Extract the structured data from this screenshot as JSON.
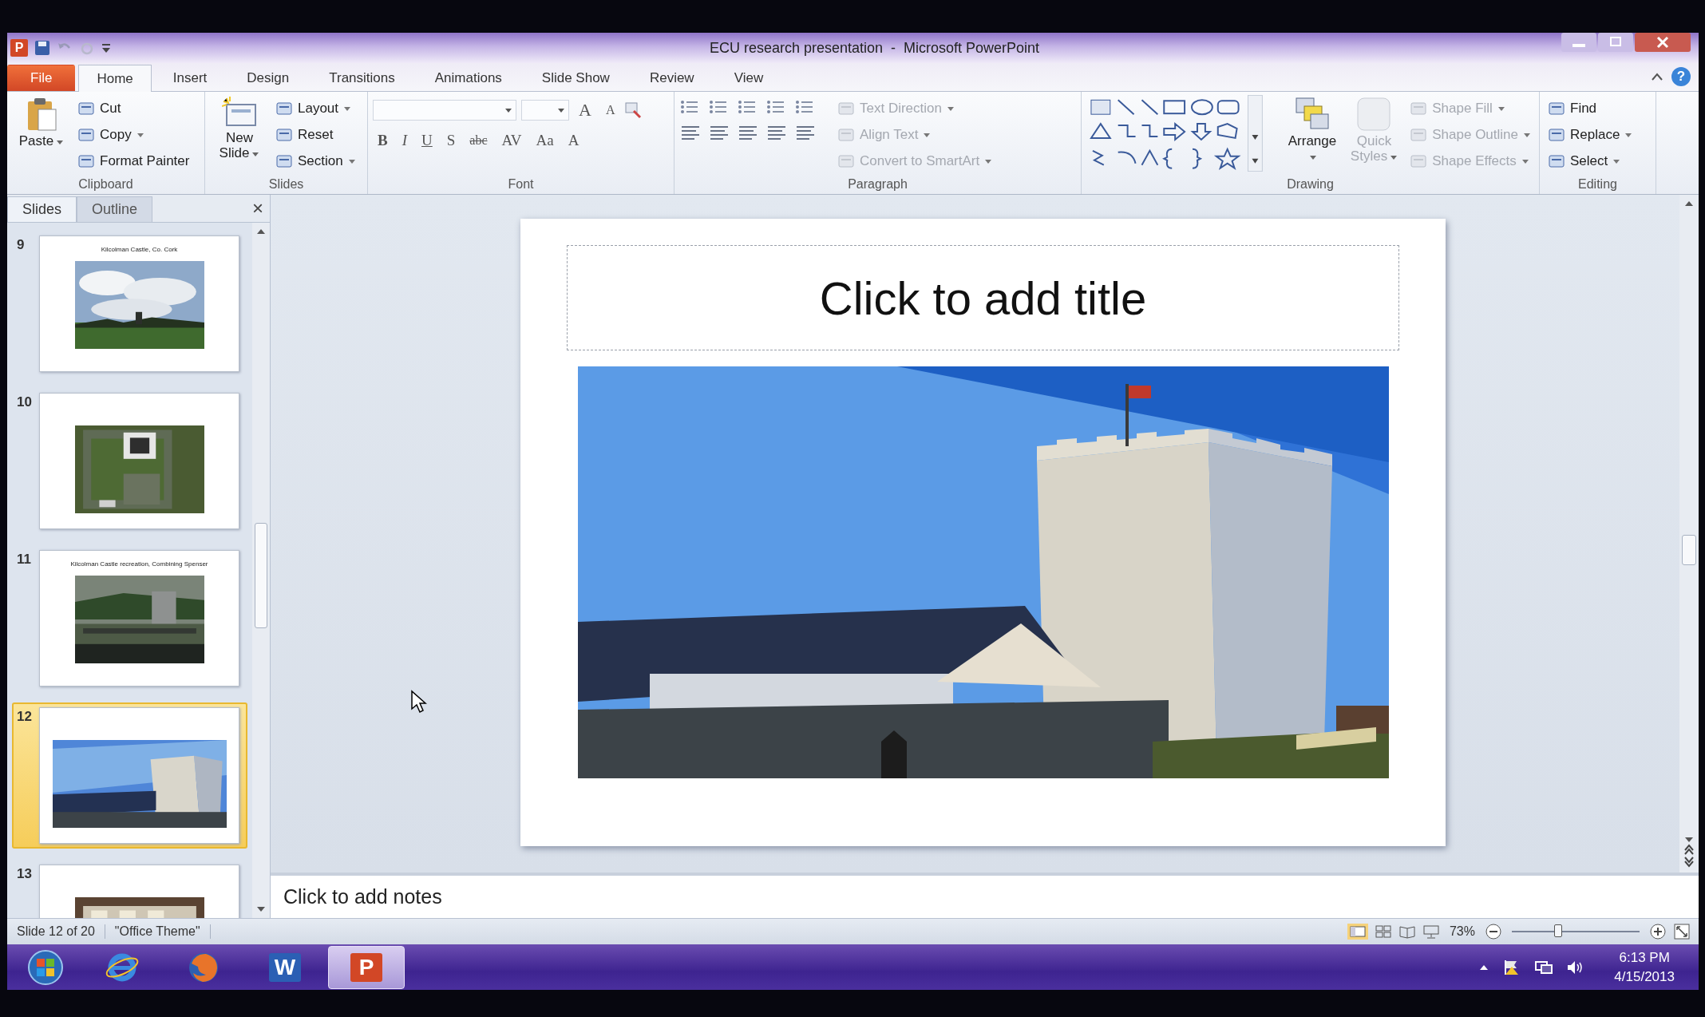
{
  "window": {
    "app_icon": "P",
    "title": "ECU research presentation  -  Microsoft PowerPoint"
  },
  "ribbon_tabs": [
    {
      "label": "File",
      "kind": "file",
      "selected": false
    },
    {
      "label": "Home",
      "kind": "tab",
      "selected": true
    },
    {
      "label": "Insert",
      "kind": "tab",
      "selected": false
    },
    {
      "label": "Design",
      "kind": "tab",
      "selected": false
    },
    {
      "label": "Transitions",
      "kind": "tab",
      "selected": false
    },
    {
      "label": "Animations",
      "kind": "tab",
      "selected": false
    },
    {
      "label": "Slide Show",
      "kind": "tab",
      "selected": false
    },
    {
      "label": "Review",
      "kind": "tab",
      "selected": false
    },
    {
      "label": "View",
      "kind": "tab",
      "selected": false
    }
  ],
  "help": "?",
  "ribbon_groups": [
    {
      "name": "Clipboard",
      "kind": "clipboard",
      "large": [
        {
          "label": "Paste",
          "disabled": false,
          "dropdown": true
        }
      ],
      "small": [
        {
          "label": "Cut",
          "disabled": false,
          "dropdown": false
        },
        {
          "label": "Copy",
          "disabled": false,
          "dropdown": true
        },
        {
          "label": "Format Painter",
          "disabled": false,
          "dropdown": false
        }
      ]
    },
    {
      "name": "Slides",
      "kind": "slides",
      "large": [
        {
          "label": "New Slide",
          "disabled": false,
          "dropdown": true
        }
      ],
      "small": [
        {
          "label": "Layout",
          "disabled": false,
          "dropdown": true
        },
        {
          "label": "Reset",
          "disabled": false,
          "dropdown": false
        },
        {
          "label": "Section",
          "disabled": false,
          "dropdown": true
        }
      ]
    },
    {
      "name": "Font",
      "kind": "font",
      "grow_shrink": [
        "A",
        "A"
      ],
      "glyphs": [
        "B",
        "I",
        "U",
        "S",
        "abc",
        "AV",
        "Aa",
        "A"
      ]
    },
    {
      "name": "Paragraph",
      "kind": "paragraph",
      "small": [
        {
          "label": "Text Direction",
          "disabled": true,
          "dropdown": true
        },
        {
          "label": "Align Text",
          "disabled": true,
          "dropdown": true
        },
        {
          "label": "Convert to SmartArt",
          "disabled": true,
          "dropdown": true
        }
      ]
    },
    {
      "name": "Drawing",
      "kind": "drawing",
      "large": [
        {
          "label": "Arrange",
          "disabled": false,
          "dropdown": true
        },
        {
          "label": "Quick Styles",
          "disabled": true,
          "dropdown": true
        }
      ],
      "small": [
        {
          "label": "Shape Fill",
          "disabled": true,
          "dropdown": true
        },
        {
          "label": "Shape Outline",
          "disabled": true,
          "dropdown": true
        },
        {
          "label": "Shape Effects",
          "disabled": true,
          "dropdown": true
        }
      ]
    },
    {
      "name": "Editing",
      "kind": "editing",
      "small": [
        {
          "label": "Find",
          "disabled": false,
          "dropdown": false
        },
        {
          "label": "Replace",
          "disabled": false,
          "dropdown": true
        },
        {
          "label": "Select",
          "disabled": false,
          "dropdown": true
        }
      ]
    }
  ],
  "slides_pane": {
    "tabs": [
      {
        "label": "Slides",
        "selected": true
      },
      {
        "label": "Outline",
        "selected": false
      }
    ],
    "close": "×",
    "thumbnails": [
      {
        "number": "9",
        "title": "Kilcolman Castle, Co. Cork",
        "selected": false
      },
      {
        "number": "10",
        "selected": false
      },
      {
        "number": "11",
        "title": "Kilcolman Castle recreation, Combining Spenser",
        "selected": false
      },
      {
        "number": "12",
        "selected": true
      },
      {
        "number": "13",
        "selected": false
      }
    ]
  },
  "slide": {
    "title_placeholder": "Click to add title"
  },
  "notes": {
    "placeholder": "Click to add notes"
  },
  "status_bar": {
    "slide": "Slide 12 of 20",
    "theme": "\"Office Theme\"",
    "zoom": "73%",
    "zoom_slider": {
      "level": 0.36
    }
  },
  "taskbar": {
    "apps": [
      {
        "kind": "start",
        "selected": false
      },
      {
        "kind": "ie",
        "selected": false
      },
      {
        "kind": "firefox",
        "selected": false
      },
      {
        "kind": "word",
        "label": "W",
        "selected": false
      },
      {
        "kind": "powerpoint",
        "label": "P",
        "selected": true
      }
    ],
    "time": "6:13 PM",
    "date": "4/15/2013"
  }
}
